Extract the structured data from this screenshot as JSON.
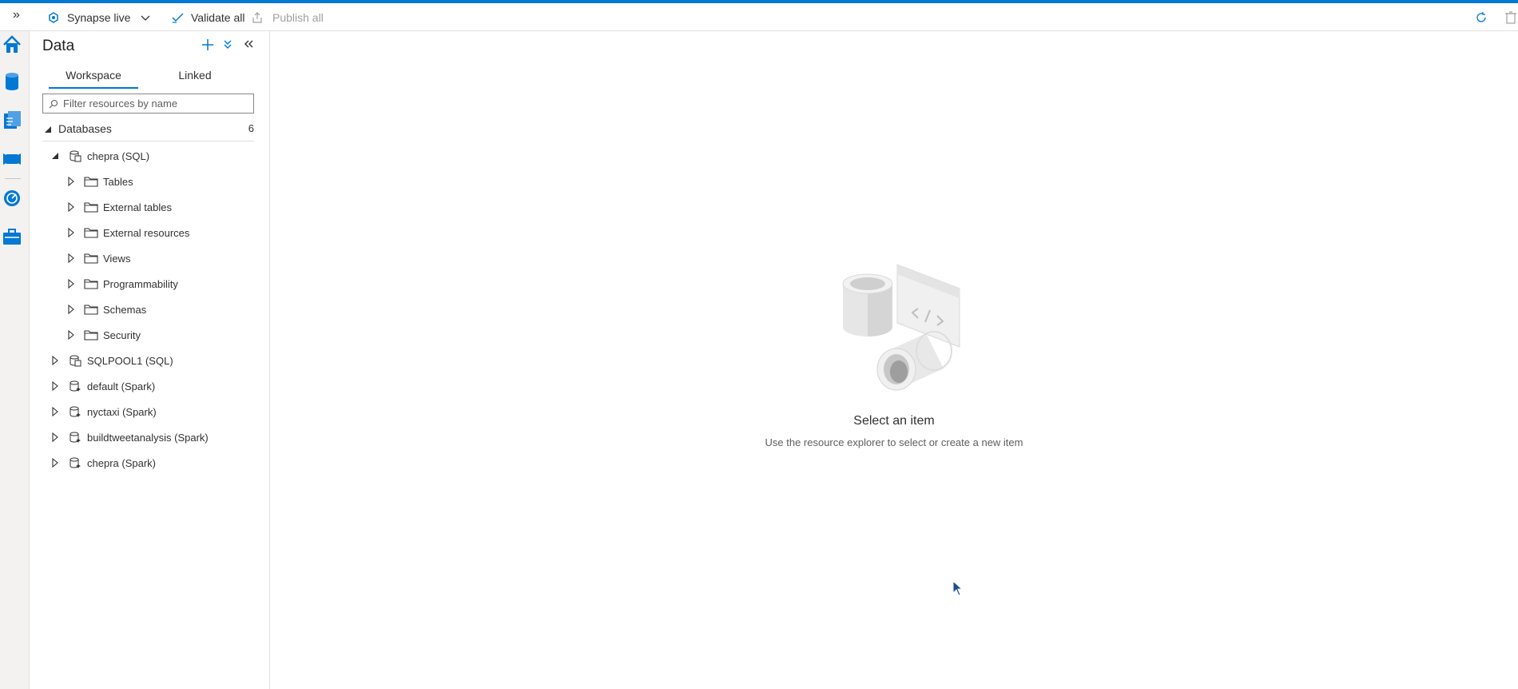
{
  "toolbar": {
    "mode_label": "Synapse live",
    "validate_label": "Validate all",
    "publish_label": "Publish all"
  },
  "rail": {
    "items": [
      "home-icon",
      "data-icon",
      "develop-icon",
      "integrate-icon",
      "monitor-icon",
      "manage-icon"
    ]
  },
  "panel": {
    "title": "Data",
    "tabs": [
      {
        "label": "Workspace",
        "active": true
      },
      {
        "label": "Linked",
        "active": false
      }
    ],
    "search_placeholder": "Filter resources by name",
    "section": {
      "label": "Databases",
      "count": "6"
    },
    "tree": [
      {
        "label": "chepra (SQL)",
        "level": 1,
        "expanded": true,
        "icon": "sql-database-icon"
      },
      {
        "label": "Tables",
        "level": 2,
        "expanded": false,
        "icon": "folder-icon"
      },
      {
        "label": "External tables",
        "level": 2,
        "expanded": false,
        "icon": "folder-icon"
      },
      {
        "label": "External resources",
        "level": 2,
        "expanded": false,
        "icon": "folder-icon"
      },
      {
        "label": "Views",
        "level": 2,
        "expanded": false,
        "icon": "folder-icon"
      },
      {
        "label": "Programmability",
        "level": 2,
        "expanded": false,
        "icon": "folder-icon"
      },
      {
        "label": "Schemas",
        "level": 2,
        "expanded": false,
        "icon": "folder-icon"
      },
      {
        "label": "Security",
        "level": 2,
        "expanded": false,
        "icon": "folder-icon"
      },
      {
        "label": "SQLPOOL1 (SQL)",
        "level": 1,
        "expanded": false,
        "icon": "sql-database-icon"
      },
      {
        "label": "default (Spark)",
        "level": 1,
        "expanded": false,
        "icon": "spark-database-icon"
      },
      {
        "label": "nyctaxi (Spark)",
        "level": 1,
        "expanded": false,
        "icon": "spark-database-icon"
      },
      {
        "label": "buildtweetanalysis (Spark)",
        "level": 1,
        "expanded": false,
        "icon": "spark-database-icon"
      },
      {
        "label": "chepra (Spark)",
        "level": 1,
        "expanded": false,
        "icon": "spark-database-icon"
      }
    ]
  },
  "main": {
    "empty_title": "Select an item",
    "empty_subtitle": "Use the resource explorer to select or create a new item"
  },
  "colors": {
    "accent": "#0078d4",
    "border": "#e1dfdd"
  }
}
